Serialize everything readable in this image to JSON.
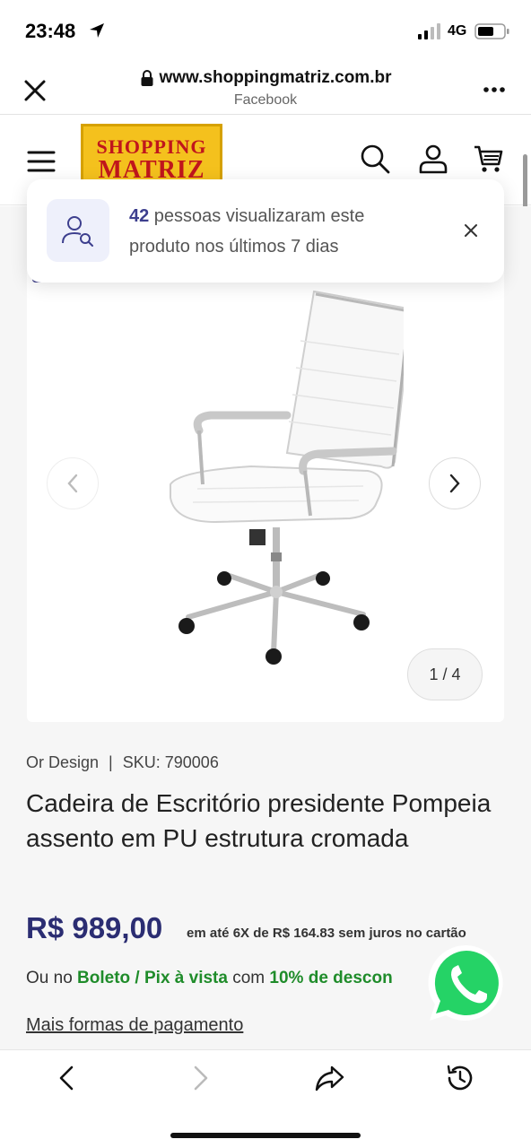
{
  "status_bar": {
    "time": "23:48",
    "network": "4G"
  },
  "browser": {
    "url": "www.shoppingmatriz.com.br",
    "source": "Facebook"
  },
  "site": {
    "logo_line1": "SHOPPING",
    "logo_line2": "MATRIZ"
  },
  "popup": {
    "count": "42",
    "text_rest": " pessoas visualizaram este produto nos últimos 7 dias"
  },
  "gallery": {
    "counter": "1 / 4"
  },
  "product": {
    "brand": "Or Design",
    "separator": "|",
    "sku": "SKU: 790006",
    "title": "Cadeira de Escritório presidente Pompeia assento em PU estrutura cromada",
    "price": "R$ 989,00",
    "installments": "em até 6X de R$ 164.83 sem juros no cartão",
    "boleto_prefix": "Ou no ",
    "boleto_method": "Boleto / Pix à vista",
    "boleto_mid": " com ",
    "boleto_discount": "10% de descon",
    "more_payment": "Mais formas de pagamento"
  },
  "colors": {
    "primary": "#2b2d72",
    "green": "#1f8c2a",
    "whatsapp": "#25d366",
    "logo_bg": "#f4c11d",
    "logo_text": "#c0161c"
  }
}
